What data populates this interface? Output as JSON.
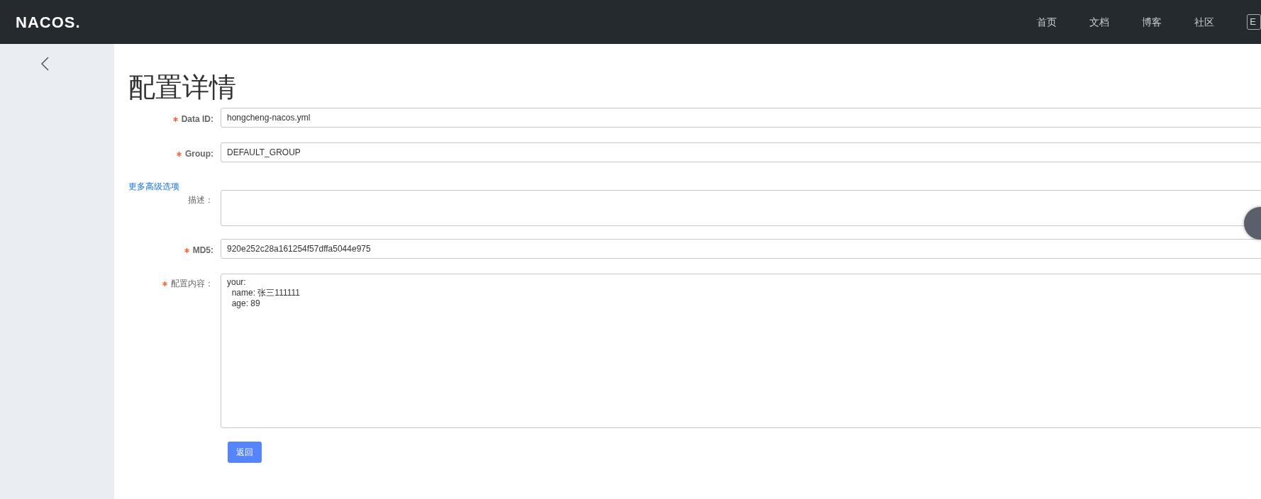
{
  "header": {
    "logo": "NACOS.",
    "nav": [
      {
        "label": "首页"
      },
      {
        "label": "文档"
      },
      {
        "label": "博客"
      },
      {
        "label": "社区"
      }
    ],
    "language_button": "E"
  },
  "page": {
    "title": "配置详情"
  },
  "form": {
    "fields": [
      {
        "kind": "input",
        "label": "Data ID:",
        "required": true,
        "value": "hongcheng-nacos.yml"
      },
      {
        "kind": "input",
        "label": "Group:",
        "required": true,
        "value": "DEFAULT_GROUP"
      },
      {
        "kind": "link",
        "label": "更多高级选项"
      },
      {
        "kind": "textarea",
        "label": "描述：",
        "required": false
      },
      {
        "kind": "input",
        "label": "MD5:",
        "required": true,
        "value": "920e252c28a161254f57dffa5044e975"
      },
      {
        "kind": "code",
        "label": "配置内容：",
        "required": true,
        "value": "your:\n  name: 张三111111\n  age: 89"
      }
    ]
  },
  "buttons": [
    {
      "label": "返回"
    }
  ]
}
